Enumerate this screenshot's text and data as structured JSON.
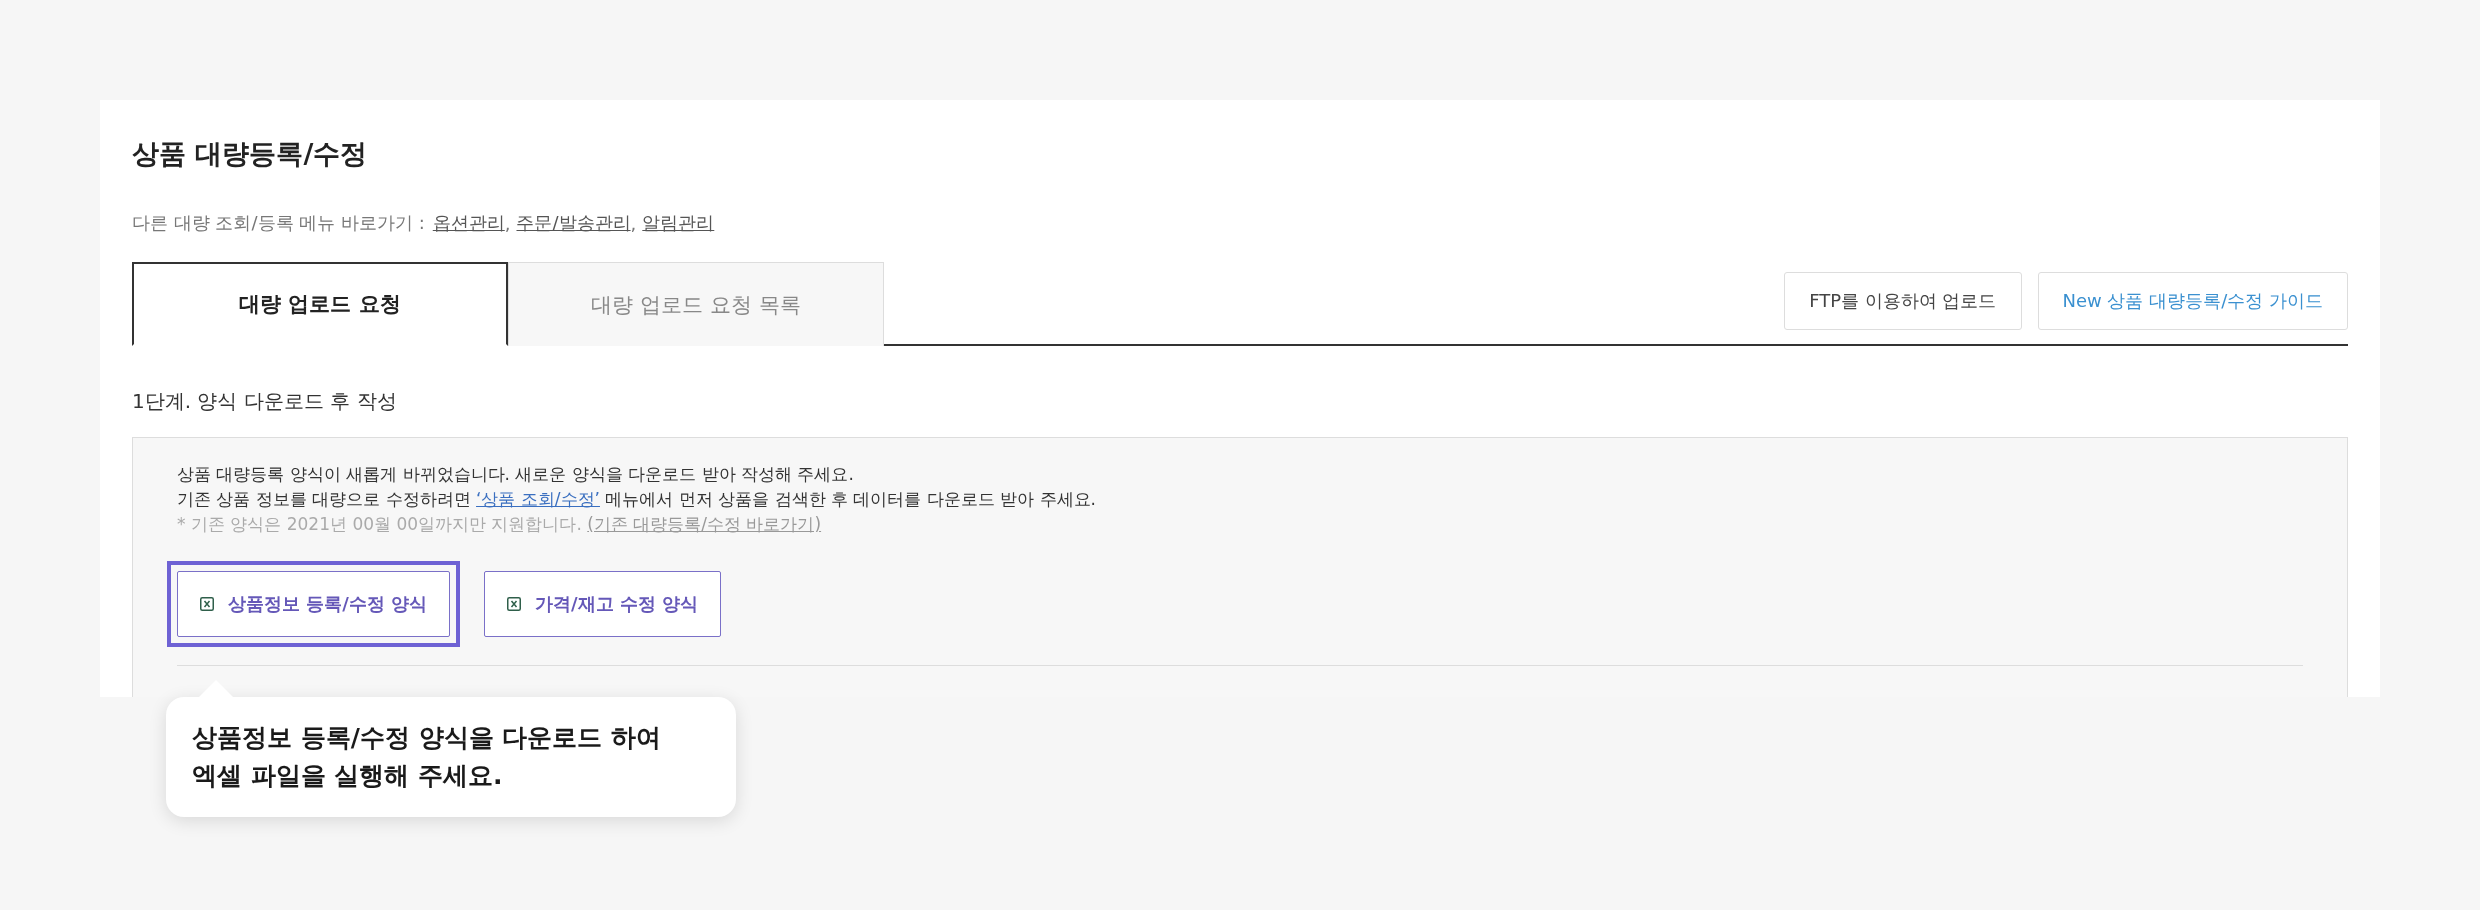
{
  "title": "상품 대량등록/수정",
  "shortcuts": {
    "label": "다른 대량 조회/등록 메뉴 바로가기 :",
    "links": [
      "옵션관리",
      "주문/발송관리",
      "알림관리"
    ],
    "separator": ","
  },
  "tabs": [
    {
      "label": "대량 업로드 요청",
      "selected": true
    },
    {
      "label": "대량 업로드 요청 목록",
      "selected": false
    }
  ],
  "actions": [
    {
      "label": "FTP를 이용하여 업로드",
      "kind": "plain"
    },
    {
      "label": "New 상품 대량등록/수정 가이드",
      "kind": "guide"
    }
  ],
  "step": "1단계. 양식 다운로드 후 작성",
  "notice": {
    "line_1": "상품 대량등록 양식이 새롭게 바뀌었습니다. 새로운 양식을 다운로드 받아 작성해 주세요.",
    "line_2": {
      "before": "기존 상품 정보를 대량으로 수정하려면",
      "link": "‘상품 조회/수정’",
      "after": "메뉴에서 먼저 상품을 검색한 후 데이터를 다운로드 받아 주세요."
    },
    "line_3": {
      "before": "* 기존 양식은 2021년 00월 00일까지만 지원합니다.",
      "link": "(기존 대량등록/수정 바로가기)"
    }
  },
  "downloads": [
    {
      "label": "상품정보 등록/수정 양식",
      "highlighted": true
    },
    {
      "label": "가격/재고 수정 양식",
      "highlighted": false
    }
  ],
  "tooltip": {
    "lines": [
      "상품정보 등록/수정 양식을 다운로드 하여",
      "엑셀 파일을 실행해 주세요."
    ]
  }
}
